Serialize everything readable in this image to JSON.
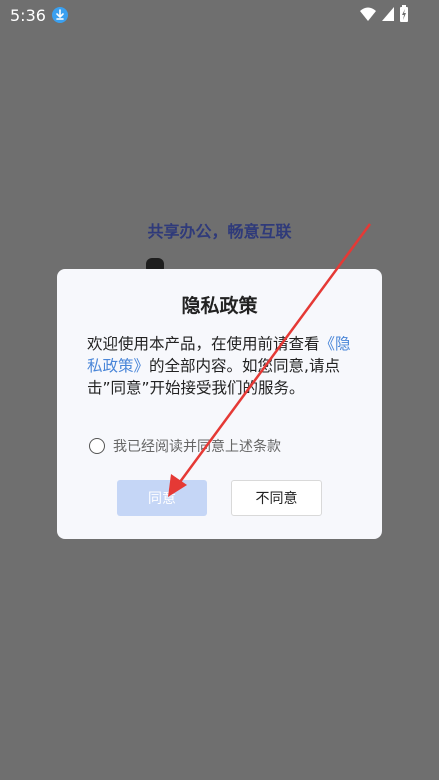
{
  "status_bar": {
    "time": "5:36",
    "icons": [
      "download-icon",
      "wifi-icon",
      "signal-icon",
      "battery-charging-icon"
    ]
  },
  "background": {
    "slogan": "共享办公，畅意互联"
  },
  "dialog": {
    "title": "隐私政策",
    "body_prefix": "欢迎使用本产品，在使用前请查看",
    "policy_link": "《隐私政策》",
    "body_suffix": "的全部内容。如您同意,请点击”同意”开始接受我们的服务。",
    "checkbox_label": "我已经阅读并同意上述条款",
    "checkbox_checked": false,
    "agree_button": "同意",
    "disagree_button": "不同意"
  },
  "annotation": {
    "arrow_color": "#e53935"
  },
  "colors": {
    "overlay": "#6f6f6f",
    "link": "#4a86d8",
    "agree_button_disabled": "#c5d6f6"
  }
}
